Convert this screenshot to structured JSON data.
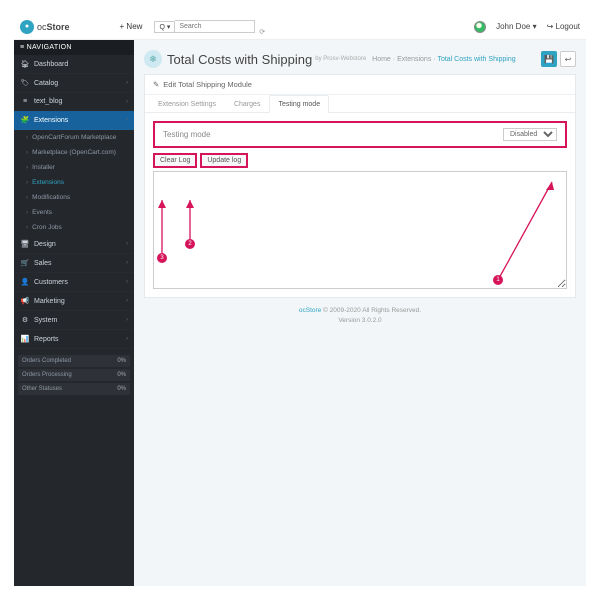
{
  "logo": {
    "oc": "oc",
    "store": "Store"
  },
  "topbar": {
    "new": "+ New",
    "search_placeholder": "Search",
    "user": "John Doe",
    "logout": "Logout"
  },
  "nav": {
    "header": "≡ NAVIGATION",
    "items": [
      {
        "icon": "🏠︎",
        "label": "Dashboard",
        "chev": false
      },
      {
        "icon": "🏷",
        "label": "Catalog",
        "chev": true
      },
      {
        "icon": "≡",
        "label": "text_blog",
        "chev": true
      },
      {
        "icon": "🧩",
        "label": "Extensions",
        "chev": true,
        "active": true
      }
    ],
    "ext_sub": [
      {
        "label": "OpenCartForum Marketplace"
      },
      {
        "label": "Marketplace (OpenCart.com)"
      },
      {
        "label": "Installer"
      },
      {
        "label": "Extensions",
        "active": true
      },
      {
        "label": "Modifications"
      },
      {
        "label": "Events"
      },
      {
        "label": "Cron Jobs"
      }
    ],
    "rest": [
      {
        "icon": "🖥",
        "label": "Design"
      },
      {
        "icon": "🛒",
        "label": "Sales"
      },
      {
        "icon": "👤",
        "label": "Customers"
      },
      {
        "icon": "📢",
        "label": "Marketing"
      },
      {
        "icon": "⚙",
        "label": "System"
      },
      {
        "icon": "📊",
        "label": "Reports"
      }
    ],
    "stats": [
      {
        "label": "Orders Completed",
        "pct": "0%"
      },
      {
        "label": "Orders Processing",
        "pct": "0%"
      },
      {
        "label": "Other Statuses",
        "pct": "0%"
      }
    ]
  },
  "page": {
    "title": "Total Costs with Shipping",
    "subtitle": "by Prosv-Webstore",
    "crumbs": {
      "home": "Home",
      "ext": "Extensions",
      "cur": "Total Costs with Shipping"
    }
  },
  "panel": {
    "head": "Edit Total Shipping Module",
    "tabs": [
      "Extension Settings",
      "Charges",
      "Testing mode"
    ],
    "mode_label": "Testing mode",
    "mode_value": "Disabled",
    "clear_log": "Clear Log",
    "update_log": "Update log"
  },
  "footer": {
    "brand": "ocStore",
    "copy": " © 2009-2020 All Rights Reserved.",
    "ver": "Version 3.0.2.0"
  },
  "anno": {
    "n1": "1",
    "n2": "2",
    "n3": "3"
  }
}
